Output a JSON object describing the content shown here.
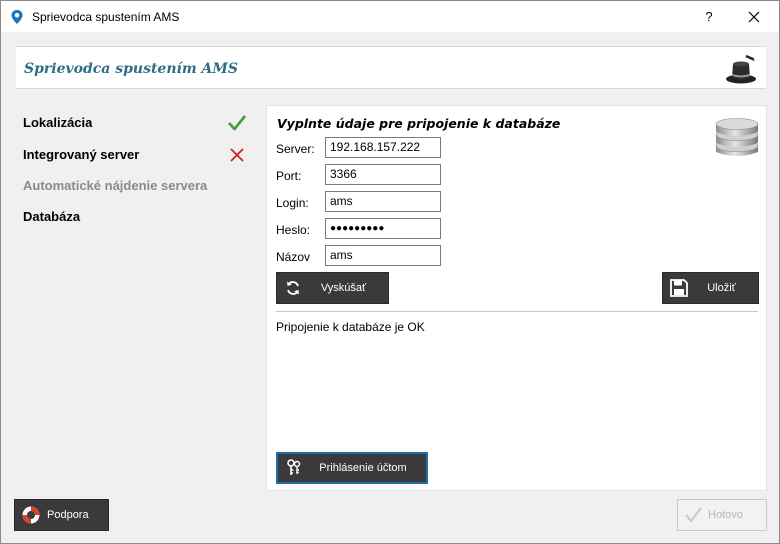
{
  "window": {
    "title": "Sprievodca spustením AMS",
    "help_glyph": "?",
    "close_glyph": "×"
  },
  "header": {
    "title": "Sprievodca spustením AMS"
  },
  "steps": [
    {
      "label": "Lokalizácia",
      "status": "done"
    },
    {
      "label": "Integrovaný server",
      "status": "failed"
    },
    {
      "label": "Automatické nájdenie servera",
      "status": "disabled"
    },
    {
      "label": "Databáza",
      "status": "current"
    }
  ],
  "panel": {
    "title": "Vyplnte údaje pre pripojenie k databáze",
    "fields": {
      "server": {
        "label": "Server:",
        "value": "192.168.157.222"
      },
      "port": {
        "label": "Port:",
        "value": "3366"
      },
      "login": {
        "label": "Login:",
        "value": "ams"
      },
      "password": {
        "label": "Heslo:",
        "value": "●●●●●●●●●"
      },
      "name": {
        "label": "Názov",
        "value": "ams"
      }
    },
    "test_button": "Vyskúšať",
    "save_button": "Uložiť",
    "status": "Pripojenie k databáze je OK",
    "account_login_button": "Prihlásenie účtom"
  },
  "footer": {
    "support_button": "Podpora",
    "done_button": "Hotovo"
  },
  "colors": {
    "header_title": "#2d6e86",
    "check_green": "#3aa040",
    "cross_red": "#d32020",
    "button_dark": "#3a3a3a",
    "focus_blue": "#1e6ea8"
  }
}
